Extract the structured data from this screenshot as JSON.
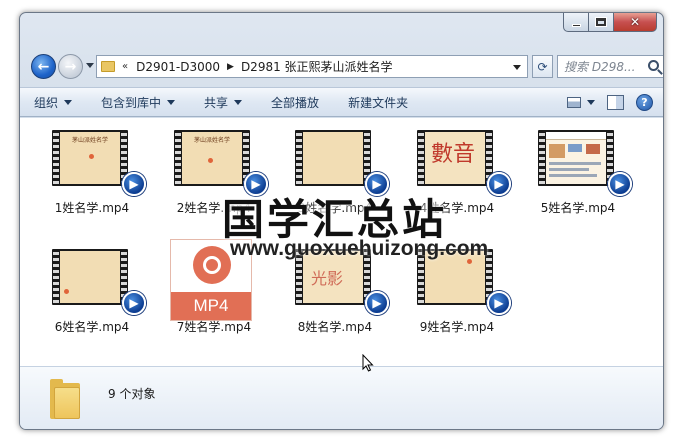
{
  "window": {
    "minimize_icon": "minimize-icon",
    "maximize_icon": "maximize-icon",
    "close_label": "✕"
  },
  "nav": {
    "breadcrumb_overflow": "«",
    "breadcrumb": [
      "D2901-D3000",
      "D2981 张正熙茅山派姓名学"
    ],
    "search_placeholder": "搜索 D298..."
  },
  "toolbar": {
    "organize": "组织",
    "include_in_library": "包含到库中",
    "share": "共享",
    "play_all": "全部播放",
    "new_folder": "新建文件夹"
  },
  "files": [
    {
      "name": "1姓名学.mp4",
      "thumb_text": "茅山派姓名学"
    },
    {
      "name": "2姓名学.mp4",
      "thumb_text": "茅山派姓名学"
    },
    {
      "name": "3姓名学.mp4",
      "thumb_text": ""
    },
    {
      "name": "4姓名学.mp4",
      "thumb_text": "數音"
    },
    {
      "name": "5姓名学.mp4",
      "thumb_text": ""
    },
    {
      "name": "6姓名学.mp4",
      "thumb_text": ""
    },
    {
      "name": "7姓名学.mp4",
      "thumb_text": "MP4"
    },
    {
      "name": "8姓名学.mp4",
      "thumb_text": "光影"
    },
    {
      "name": "9姓名学.mp4",
      "thumb_text": ""
    }
  ],
  "details": {
    "item_count": "9 个对象"
  },
  "watermark": {
    "title": "国学汇总站",
    "url": "www.guoxuehuizong.com"
  }
}
